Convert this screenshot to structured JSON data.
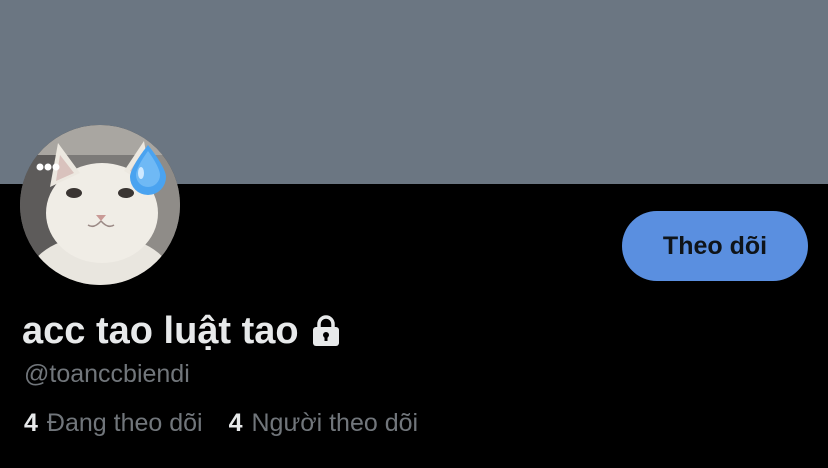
{
  "profile": {
    "display_name": "acc tao luật tao",
    "handle": "@toanccbiendi",
    "follow_button_label": "Theo dõi",
    "protected_icon": "lock-icon",
    "avatar_icon": "cat-avatar",
    "stats": {
      "following_count": "4",
      "following_label": "Đang theo dõi",
      "followers_count": "4",
      "followers_label": "Người theo dõi"
    }
  },
  "colors": {
    "banner": "#6b7682",
    "background": "#000000",
    "follow_button": "#5a8fe0",
    "primary_text": "#e7e9ea",
    "secondary_text": "#71767b"
  }
}
